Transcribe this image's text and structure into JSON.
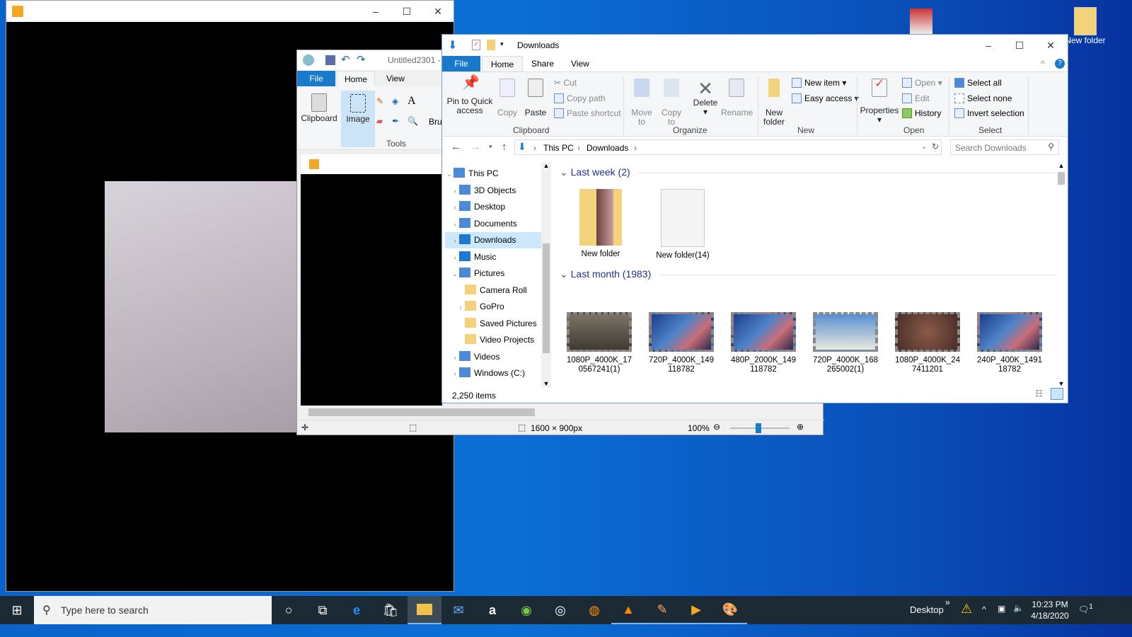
{
  "desktop": {
    "icons": [
      {
        "label": "New folder"
      }
    ]
  },
  "player": {
    "title": ""
  },
  "paint": {
    "title": "Untitled2301 -",
    "tabs": [
      "File",
      "Home",
      "View"
    ],
    "groups": {
      "clipboard": "Clipboard",
      "image": "Image",
      "tools": "Tools",
      "brushes": "Bru"
    },
    "status": {
      "dimensions": "1600 × 900px",
      "zoom": "100%",
      "zoom_level_percent": 100
    }
  },
  "explorer": {
    "title": "Downloads",
    "tabs": [
      "File",
      "Home",
      "Share",
      "View"
    ],
    "ribbon": {
      "clipboard": {
        "label": "Clipboard",
        "pin": "Pin to Quick access",
        "copy": "Copy",
        "paste": "Paste",
        "cut": "Cut",
        "copy_path": "Copy path",
        "paste_shortcut": "Paste shortcut"
      },
      "organize": {
        "label": "Organize",
        "move_to": "Move to",
        "copy_to": "Copy to",
        "delete": "Delete",
        "rename": "Rename"
      },
      "new": {
        "label": "New",
        "new_folder": "New folder",
        "new_item": "New item",
        "easy_access": "Easy access"
      },
      "open": {
        "label": "Open",
        "properties": "Properties",
        "open": "Open",
        "edit": "Edit",
        "history": "History"
      },
      "select": {
        "label": "Select",
        "select_all": "Select all",
        "select_none": "Select none",
        "invert": "Invert selection"
      }
    },
    "breadcrumb": [
      "This PC",
      "Downloads"
    ],
    "search_placeholder": "Search Downloads",
    "nav": [
      {
        "label": "This PC",
        "level": 0,
        "expanded": true
      },
      {
        "label": "3D Objects",
        "level": 1
      },
      {
        "label": "Desktop",
        "level": 1
      },
      {
        "label": "Documents",
        "level": 1
      },
      {
        "label": "Downloads",
        "level": 1,
        "selected": true
      },
      {
        "label": "Music",
        "level": 1
      },
      {
        "label": "Pictures",
        "level": 1,
        "expanded": true
      },
      {
        "label": "Camera Roll",
        "level": 2
      },
      {
        "label": "GoPro",
        "level": 2
      },
      {
        "label": "Saved Pictures",
        "level": 2
      },
      {
        "label": "Video Projects",
        "level": 2
      },
      {
        "label": "Videos",
        "level": 1
      },
      {
        "label": "Windows (C:)",
        "level": 1
      }
    ],
    "groups": [
      {
        "header": "Last week (2)",
        "items": [
          "New folder",
          "New folder(14)"
        ]
      },
      {
        "header": "Last month (1983)",
        "items": [
          "1080P_4000K_170567241(1)",
          "720P_4000K_149118782",
          "480P_2000K_149118782",
          "720P_4000K_168265002(1)",
          "1080P_4000K_247411201",
          "240P_400K_149118782"
        ]
      }
    ],
    "status": "2,250 items"
  },
  "taskbar": {
    "search_placeholder": "Type here to search",
    "desktop_label": "Desktop",
    "time": "10:23 PM",
    "date": "4/18/2020",
    "notifications": "1"
  }
}
